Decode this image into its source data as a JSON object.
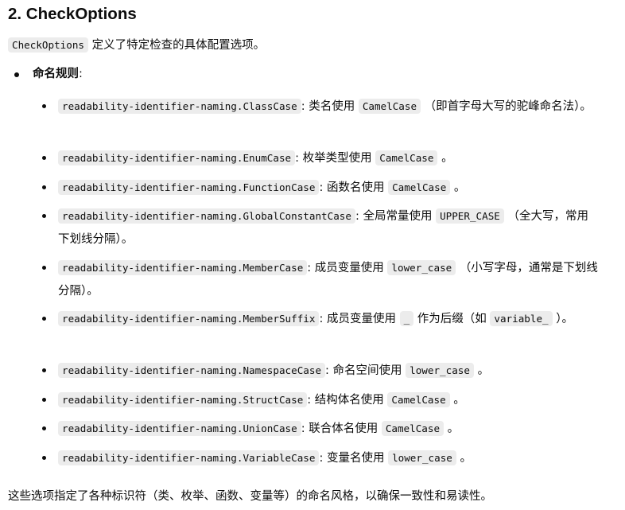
{
  "title": "2. CheckOptions",
  "intro": {
    "code": "CheckOptions",
    "text": " 定义了特定检查的具体配置选项。"
  },
  "naming": {
    "label": "命名规则",
    "colon": ":"
  },
  "items": [
    {
      "key": "readability-identifier-naming.ClassCase",
      "pre": ": 类名使用 ",
      "code": "CamelCase",
      "post": " （即首字母大写的驼峰命名法）。"
    },
    {
      "key": "readability-identifier-naming.EnumCase",
      "pre": ": 枚举类型使用 ",
      "code": "CamelCase",
      "post": " 。"
    },
    {
      "key": "readability-identifier-naming.FunctionCase",
      "pre": ": 函数名使用 ",
      "code": "CamelCase",
      "post": " 。"
    },
    {
      "key": "readability-identifier-naming.GlobalConstantCase",
      "pre": ": 全局常量使用 ",
      "code": "UPPER_CASE",
      "post": " （全大写，常用下划线分隔）。"
    },
    {
      "key": "readability-identifier-naming.MemberCase",
      "pre": ": 成员变量使用 ",
      "code": "lower_case",
      "post": " （小写字母，通常是下划线分隔）。"
    },
    {
      "key": "readability-identifier-naming.MemberSuffix",
      "pre": ": 成员变量使用 ",
      "code": "_",
      "mid": " 作为后缀（如 ",
      "code2": "variable_",
      "post": " ）。"
    },
    {
      "key": "readability-identifier-naming.NamespaceCase",
      "pre": ": 命名空间使用 ",
      "code": "lower_case",
      "post": " 。"
    },
    {
      "key": "readability-identifier-naming.StructCase",
      "pre": ": 结构体名使用 ",
      "code": "CamelCase",
      "post": " 。"
    },
    {
      "key": "readability-identifier-naming.UnionCase",
      "pre": ": 联合体名使用 ",
      "code": "CamelCase",
      "post": " 。"
    },
    {
      "key": "readability-identifier-naming.VariableCase",
      "pre": ": 变量名使用 ",
      "code": "lower_case",
      "post": " 。"
    }
  ],
  "outro": "这些选项指定了各种标识符（类、枚举、函数、变量等）的命名风格，以确保一致性和易读性。"
}
